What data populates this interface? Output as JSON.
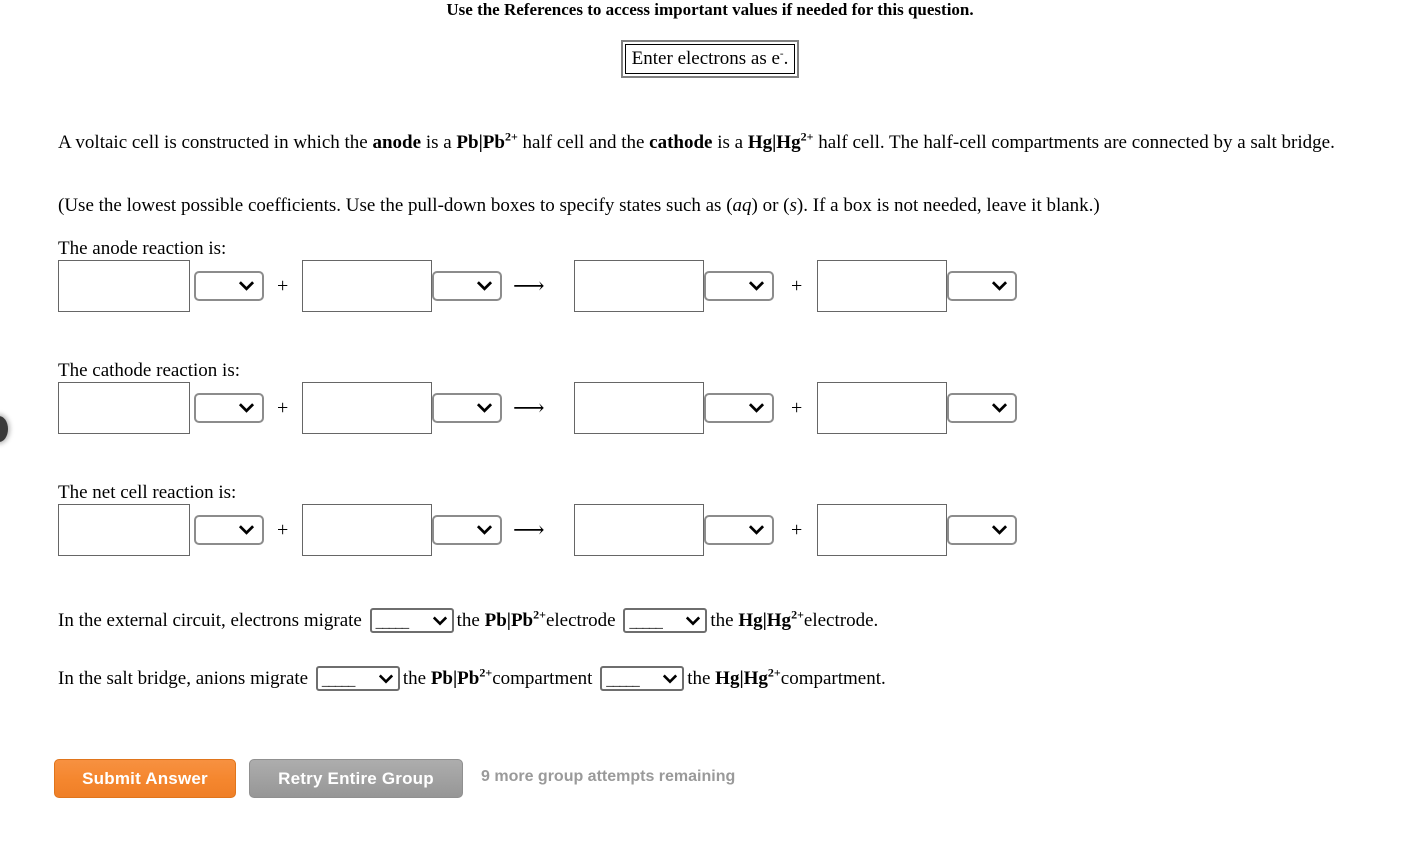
{
  "header": {
    "reference_notice": "Use the References to access important values if needed for this question.",
    "hint_box": "Enter electrons as e",
    "hint_box_sup": "-",
    "hint_box_tail": "."
  },
  "prompt": {
    "part1": "A voltaic cell is constructed in which the ",
    "anode_word": "anode",
    "part2": " is a ",
    "anode_species": "Pb|Pb",
    "anode_charge": "2+",
    "part3": " half cell and the ",
    "cathode_word": "cathode",
    "part4": " is a ",
    "cathode_species": "Hg|Hg",
    "cathode_charge": "2+",
    "part5": " half cell. The half-cell compartments are connected by a salt bridge.",
    "instructions_part1": "(Use the lowest possible coefficients. Use the pull-down boxes to specify states such as (",
    "instructions_aq": "aq",
    "instructions_part2": ") or (",
    "instructions_s": "s",
    "instructions_part3": "). If a box is not needed, leave it blank.)"
  },
  "reactions": [
    {
      "label": "The anode reaction is:",
      "reactant1_value": "",
      "reactant1_state": "",
      "plus1": "+",
      "reactant2_value": "",
      "reactant2_state": "",
      "arrow": "⟶",
      "product1_value": "",
      "product1_state": "",
      "plus2": "+",
      "product2_value": "",
      "product2_state": ""
    },
    {
      "label": "The cathode reaction is:",
      "reactant1_value": "",
      "reactant1_state": "",
      "plus1": "+",
      "reactant2_value": "",
      "reactant2_state": "",
      "arrow": "⟶",
      "product1_value": "",
      "product1_state": "",
      "plus2": "+",
      "product2_value": "",
      "product2_state": ""
    },
    {
      "label": "The net cell reaction is:",
      "reactant1_value": "",
      "reactant1_state": "",
      "plus1": "+",
      "reactant2_value": "",
      "reactant2_state": "",
      "arrow": "⟶",
      "product1_value": "",
      "product1_state": "",
      "plus2": "+",
      "product2_value": "",
      "product2_state": ""
    }
  ],
  "migration": {
    "external": {
      "lead_text": "In the external circuit, electrons migrate",
      "direction1_placeholder": "_____",
      "mid_text1": "the",
      "electrode1": "Pb|Pb",
      "electrode1_charge": "2+",
      "mid_text2": "electrode",
      "direction2_placeholder": "_____",
      "mid_text3": "the",
      "electrode2": "Hg|Hg",
      "electrode2_charge": "2+",
      "tail_text": "electrode."
    },
    "salt_bridge": {
      "lead_text": "In the salt bridge, anions migrate",
      "direction1_placeholder": "_____",
      "mid_text1": "the",
      "electrode1": "Pb|Pb",
      "electrode1_charge": "2+",
      "mid_text2": "compartment",
      "direction2_placeholder": "_____",
      "mid_text3": "the",
      "electrode2": "Hg|Hg",
      "electrode2_charge": "2+",
      "tail_text": "compartment."
    }
  },
  "footer": {
    "submit_label": "Submit Answer",
    "retry_label": "Retry Entire Group",
    "attempts_text": "9 more group attempts remaining"
  },
  "colors": {
    "submit_orange": "#F5872F",
    "retry_gray": "#A2A2A2",
    "attempts_gray": "#9A9A9A",
    "input_border": "#666666",
    "select_border": "#8C8C8C"
  }
}
